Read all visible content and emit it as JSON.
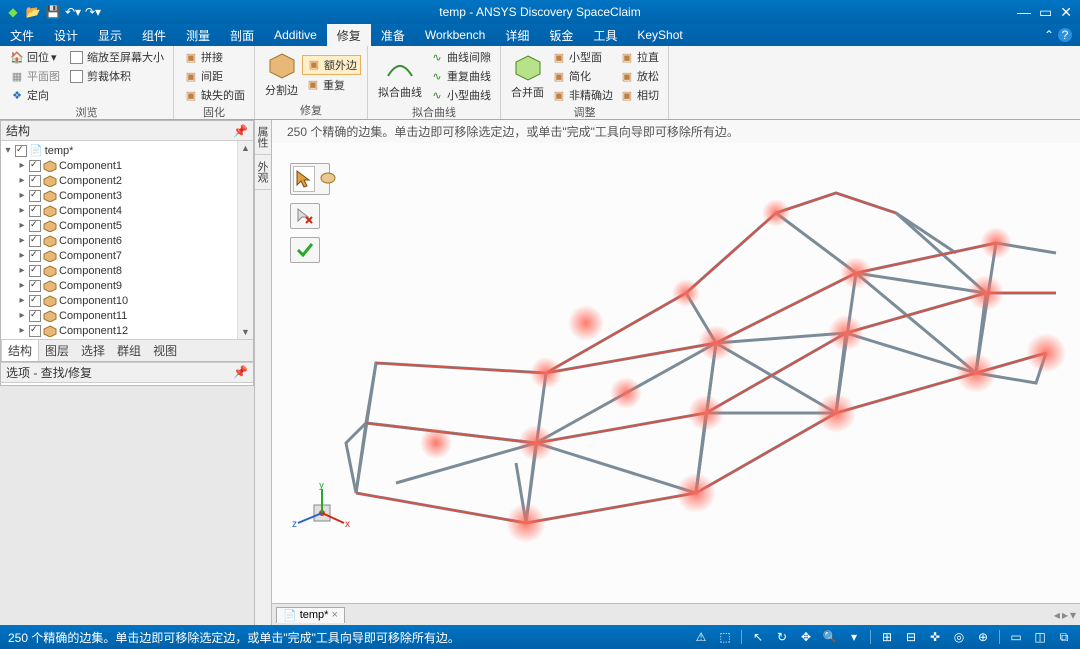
{
  "colors": {
    "brandBlue": "#0068b4",
    "highlight": "#ffefc9"
  },
  "title": "temp - ANSYS Discovery SpaceClaim",
  "qat_icons": [
    "app",
    "open",
    "save",
    "undo",
    "redo"
  ],
  "menus": [
    "文件",
    "设计",
    "显示",
    "组件",
    "测量",
    "剖面",
    "Additive",
    "修复",
    "准备",
    "Workbench",
    "详细",
    "钣金",
    "工具",
    "KeyShot"
  ],
  "active_menu": "修复",
  "ribbon": {
    "g1": {
      "home": "回位",
      "plan": "平面图",
      "orient": "定向",
      "label": "浏览"
    },
    "g2": {
      "fit": "缩放至屏幕大小",
      "clip": "剪裁体积"
    },
    "g3": {
      "a": "拼接",
      "b": "间距",
      "c": "缺失的面",
      "label": "固化"
    },
    "g4": {
      "split": "分割边",
      "extra": "额外边",
      "dup": "重复",
      "label": "修复"
    },
    "g5": {
      "fitc": "拟合曲线",
      "a": "曲线间隙",
      "b": "重复曲线",
      "c": "小型曲线",
      "label": "拟合曲线"
    },
    "g6": {
      "merge": "合并面",
      "a": "小型面",
      "b": "简化",
      "c": "非精确边",
      "d": "拉直",
      "e": "放松",
      "f": "相切",
      "label": "调整"
    }
  },
  "left": {
    "struct": "结构",
    "root": "temp*",
    "components": [
      "Component1",
      "Component2",
      "Component3",
      "Component4",
      "Component5",
      "Component6",
      "Component7",
      "Component8",
      "Component9",
      "Component10",
      "Component11",
      "Component12"
    ],
    "tabs": [
      "结构",
      "图层",
      "选择",
      "群组",
      "视图"
    ],
    "active_tab": "结构",
    "options_header": "选项 - 查找/修复"
  },
  "side_tabs": [
    "属性",
    "外观"
  ],
  "viewport_msg": "250 个精确的边集。单击边即可移除选定边，或单击\"完成\"工具向导即可移除所有边。",
  "doc_tab": "temp*",
  "status_msg": "250 个精确的边集。单击边即可移除选定边，或单击\"完成\"工具向导即可移除所有边。"
}
